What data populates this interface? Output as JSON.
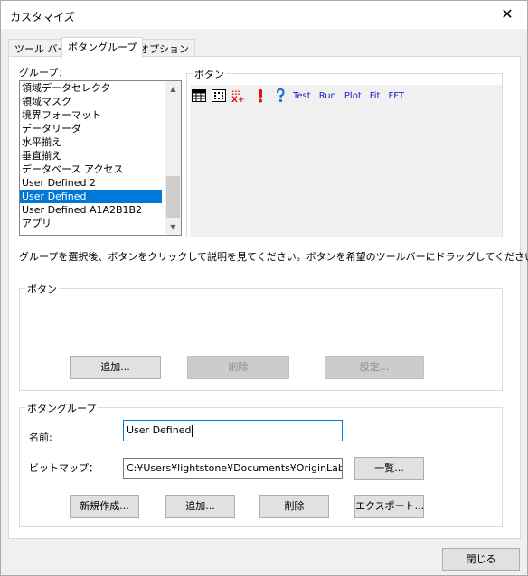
{
  "window": {
    "title": "カスタマイズ",
    "close_symbol": "✕"
  },
  "tabs": [
    {
      "label": "ツール バー",
      "active": false
    },
    {
      "label": "ボタングループ",
      "active": true
    },
    {
      "label": "オプション",
      "active": false
    }
  ],
  "group_list": {
    "label": "グループ：",
    "items": [
      "領域データセレクタ",
      "領域マスク",
      "境界フォーマット",
      "データリーダ",
      "水平揃え",
      "垂直揃え",
      "データベース アクセス",
      "User Defined 2",
      "User Defined",
      "User Defined A1A2B1B2",
      "アプリ"
    ],
    "selected": "User Defined"
  },
  "buttons_panel": {
    "label": "ボタン",
    "icons": [
      "worksheet-grid-icon",
      "dot-matrix-icon",
      "xy-plus-icon",
      "exclamation-icon",
      "question-icon"
    ],
    "text_buttons": [
      "Test",
      "Run",
      "Plot",
      "Fit",
      "FFT"
    ]
  },
  "instruction": "グループを選択後、ボタンをクリックして説明を見てください。ボタンを希望のツールバーにドラッグしてください。",
  "button_section": {
    "label": "ボタン",
    "add_label": "追加...",
    "delete_label": "削除",
    "settings_label": "設定..."
  },
  "group_section": {
    "label": "ボタングループ",
    "name_label": "名前:",
    "name_value": "User Defined",
    "bitmap_label": "ビットマップ：",
    "bitmap_value": "C:¥Users¥lightstone¥Documents¥OriginLab¥U",
    "list_label": "一覧...",
    "new_label": "新規作成...",
    "add_label": "追加...",
    "delete_label": "削除",
    "export_label": "エクスポート..."
  },
  "footer": {
    "close_label": "閉じる"
  },
  "colors": {
    "accent": "#0078d7",
    "link_text": "#1c24c8",
    "icon_red": "#e01010",
    "icon_blue": "#1f6fe0"
  }
}
